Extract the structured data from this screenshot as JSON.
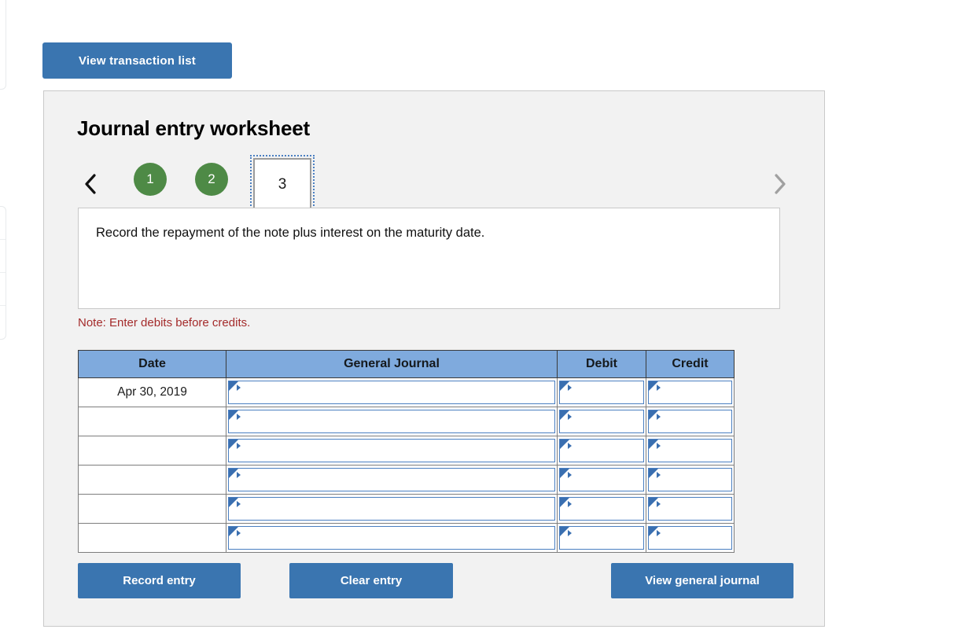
{
  "top_actions": {
    "view_transaction_list_label": "View transaction list"
  },
  "worksheet": {
    "title": "Journal entry worksheet",
    "pager": {
      "prev_icon": "chevron-left-icon",
      "next_icon": "chevron-right-icon",
      "steps": [
        {
          "label": "1",
          "state": "completed"
        },
        {
          "label": "2",
          "state": "completed"
        },
        {
          "label": "3",
          "state": "active"
        }
      ],
      "completed_color": "#4e8a46",
      "active_focus_color": "#4a7fc1"
    },
    "description": "Record the repayment of the note plus interest on the maturity date.",
    "note": "Note: Enter debits before credits.",
    "note_color": "#a42b2b",
    "table": {
      "headers": [
        "Date",
        "General Journal",
        "Debit",
        "Credit"
      ],
      "header_bg": "#7faadd",
      "rows": [
        {
          "date": "Apr 30, 2019",
          "general_journal": "",
          "debit": "",
          "credit": ""
        },
        {
          "date": "",
          "general_journal": "",
          "debit": "",
          "credit": ""
        },
        {
          "date": "",
          "general_journal": "",
          "debit": "",
          "credit": ""
        },
        {
          "date": "",
          "general_journal": "",
          "debit": "",
          "credit": ""
        },
        {
          "date": "",
          "general_journal": "",
          "debit": "",
          "credit": ""
        },
        {
          "date": "",
          "general_journal": "",
          "debit": "",
          "credit": ""
        }
      ]
    },
    "footer_actions": {
      "record_entry_label": "Record entry",
      "clear_entry_label": "Clear entry",
      "view_general_journal_label": "View general journal",
      "button_color": "#3a75b0"
    }
  }
}
